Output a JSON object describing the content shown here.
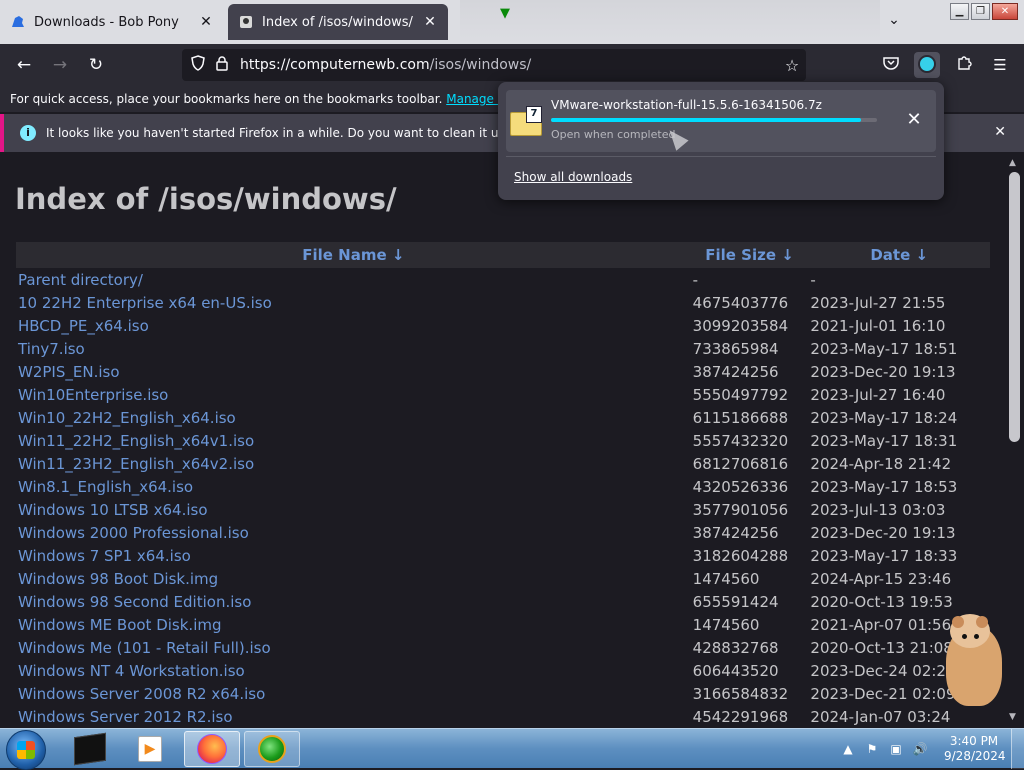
{
  "tabs": [
    {
      "label": "Downloads - Bob Pony",
      "icon": "bob-pony-icon",
      "close": "✕"
    },
    {
      "label": "Index of /isos/windows/",
      "icon": "page-favicon",
      "close": "✕"
    }
  ],
  "nav": {
    "back": "←",
    "forward": "→",
    "reload": "↻",
    "url_host": "https://computernewb.com",
    "url_path": "/isos/windows/"
  },
  "bookmarks_bar": {
    "text": "For quick access, place your bookmarks here on the bookmarks toolbar.",
    "link": "Manage bookmarks..."
  },
  "notification": {
    "text": "It looks like you haven't started Firefox in a while. Do you want to clean it up for a fresh"
  },
  "page": {
    "title": "Index of /isos/windows/",
    "headers": {
      "name": "File Name  ↓",
      "size": "File Size  ↓",
      "date": "Date  ↓"
    },
    "rows": [
      {
        "name": "Parent directory/",
        "size": "-",
        "date": "-"
      },
      {
        "name": "10 22H2 Enterprise x64 en-US.iso",
        "size": "4675403776",
        "date": "2023-Jul-27 21:55"
      },
      {
        "name": "HBCD_PE_x64.iso",
        "size": "3099203584",
        "date": "2021-Jul-01 16:10"
      },
      {
        "name": "Tiny7.iso",
        "size": "733865984",
        "date": "2023-May-17 18:51"
      },
      {
        "name": "W2PIS_EN.iso",
        "size": "387424256",
        "date": "2023-Dec-20 19:13"
      },
      {
        "name": "Win10Enterprise.iso",
        "size": "5550497792",
        "date": "2023-Jul-27 16:40"
      },
      {
        "name": "Win10_22H2_English_x64.iso",
        "size": "6115186688",
        "date": "2023-May-17 18:24"
      },
      {
        "name": "Win11_22H2_English_x64v1.iso",
        "size": "5557432320",
        "date": "2023-May-17 18:31"
      },
      {
        "name": "Win11_23H2_English_x64v2.iso",
        "size": "6812706816",
        "date": "2024-Apr-18 21:42"
      },
      {
        "name": "Win8.1_English_x64.iso",
        "size": "4320526336",
        "date": "2023-May-17 18:53"
      },
      {
        "name": "Windows 10 LTSB x64.iso",
        "size": "3577901056",
        "date": "2023-Jul-13 03:03"
      },
      {
        "name": "Windows 2000 Professional.iso",
        "size": "387424256",
        "date": "2023-Dec-20 19:13"
      },
      {
        "name": "Windows 7 SP1 x64.iso",
        "size": "3182604288",
        "date": "2023-May-17 18:33"
      },
      {
        "name": "Windows 98 Boot Disk.img",
        "size": "1474560",
        "date": "2024-Apr-15 23:46"
      },
      {
        "name": "Windows 98 Second Edition.iso",
        "size": "655591424",
        "date": "2020-Oct-13 19:53"
      },
      {
        "name": "Windows ME Boot Disk.img",
        "size": "1474560",
        "date": "2021-Apr-07 01:56"
      },
      {
        "name": "Windows Me (101 - Retail Full).iso",
        "size": "428832768",
        "date": "2020-Oct-13 21:08"
      },
      {
        "name": "Windows NT 4 Workstation.iso",
        "size": "606443520",
        "date": "2023-Dec-24 02:21"
      },
      {
        "name": "Windows Server 2008 R2 x64.iso",
        "size": "3166584832",
        "date": "2023-Dec-21 02:09"
      },
      {
        "name": "Windows Server 2012 R2.iso",
        "size": "4542291968",
        "date": "2024-Jan-07 03:24"
      }
    ]
  },
  "downloads": {
    "filename": "VMware-workstation-full-15.5.6-16341506.7z",
    "file_badge": "7",
    "progress": 0.95,
    "status": "Open when completed",
    "cancel": "✕",
    "show_all": "Show all downloads"
  },
  "taskbar": {
    "time": "3:40 PM",
    "date": "9/28/2024"
  },
  "colors": {
    "link": "#6b96d6",
    "accent": "#00ddff",
    "notification_border": "#e31587",
    "page_bg": "#1c1b22"
  }
}
